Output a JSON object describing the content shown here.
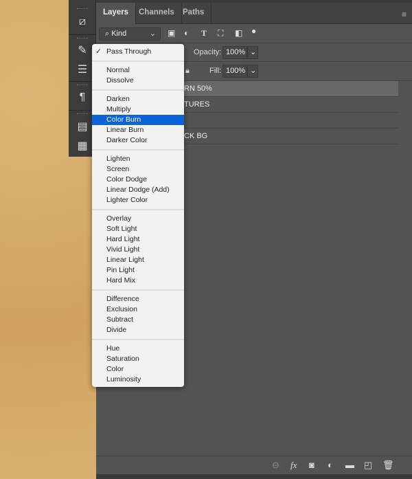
{
  "tabs": [
    "Layers",
    "Channels",
    "Paths"
  ],
  "filter": {
    "kind_label": "Kind",
    "icons": [
      "image-filter-icon",
      "adjustment-filter-icon",
      "type-filter-icon",
      "shape-filter-icon",
      "smart-object-filter-icon",
      "filter-toggle-icon"
    ]
  },
  "opacity": {
    "label": "Opacity:",
    "value": "100%"
  },
  "fill": {
    "label": "Fill:",
    "value": "100%"
  },
  "layers": [
    {
      "name": "RN 50%",
      "selected": true
    },
    {
      "name": "TURES"
    },
    {
      "name": ""
    },
    {
      "name": "CK BG"
    }
  ],
  "blend_menu": {
    "selected": "Pass Through",
    "highlighted": "Color Burn",
    "groups": [
      [
        "Pass Through"
      ],
      [
        "Normal",
        "Dissolve"
      ],
      [
        "Darken",
        "Multiply",
        "Color Burn",
        "Linear Burn",
        "Darker Color"
      ],
      [
        "Lighten",
        "Screen",
        "Color Dodge",
        "Linear Dodge (Add)",
        "Lighter Color"
      ],
      [
        "Overlay",
        "Soft Light",
        "Hard Light",
        "Vivid Light",
        "Linear Light",
        "Pin Light",
        "Hard Mix"
      ],
      [
        "Difference",
        "Exclusion",
        "Subtract",
        "Divide"
      ],
      [
        "Hue",
        "Saturation",
        "Color",
        "Luminosity"
      ]
    ]
  },
  "colors": {
    "highlight": "#0a64d8",
    "panel": "#535353",
    "selected_layer": "#686868"
  }
}
